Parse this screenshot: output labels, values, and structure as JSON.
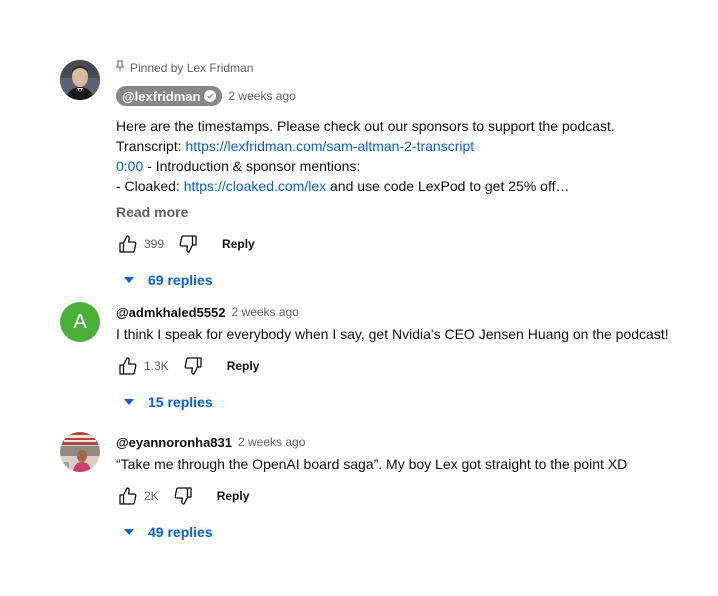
{
  "comments": [
    {
      "pinned_label": "Pinned by Lex Fridman",
      "author": "@lexfridman",
      "time": "2 weeks ago",
      "lines": {
        "l1": "Here are the timestamps. Please check out our sponsors to support the podcast.",
        "l2_prefix": "Transcript: ",
        "l2_link": "https://lexfridman.com/sam-altman-2-transcript",
        "l3_link": "0:00",
        "l3_text": " - Introduction & sponsor mentions:",
        "l4_prefix": "- Cloaked: ",
        "l4_link": "https://cloaked.com/lex",
        "l4_text": " and use code LexPod to get 25% off…"
      },
      "read_more": "Read more",
      "likes": "399",
      "reply_label": "Reply",
      "replies_label": "69 replies"
    },
    {
      "avatar_letter": "A",
      "author": "@admkhaled5552",
      "time": "2 weeks ago",
      "text": "I think I speak for everybody when I say, get Nvidia's CEO Jensen Huang on the podcast!",
      "likes": "1.3K",
      "reply_label": "Reply",
      "replies_label": "15 replies"
    },
    {
      "author": "@eyannoronha831",
      "time": "2 weeks ago",
      "text": "“Take me through the OpenAI board saga”. My boy Lex got straight to the point XD",
      "likes": "2K",
      "reply_label": "Reply",
      "replies_label": "49 replies"
    }
  ],
  "colors": {
    "link": "#065fd4",
    "secondary_text": "#606060",
    "avatar_green": "#4caf3a",
    "author_chip": "#888888"
  },
  "icons": [
    "pin-icon",
    "verified-icon",
    "like-icon",
    "dislike-icon",
    "caret-down-icon"
  ]
}
